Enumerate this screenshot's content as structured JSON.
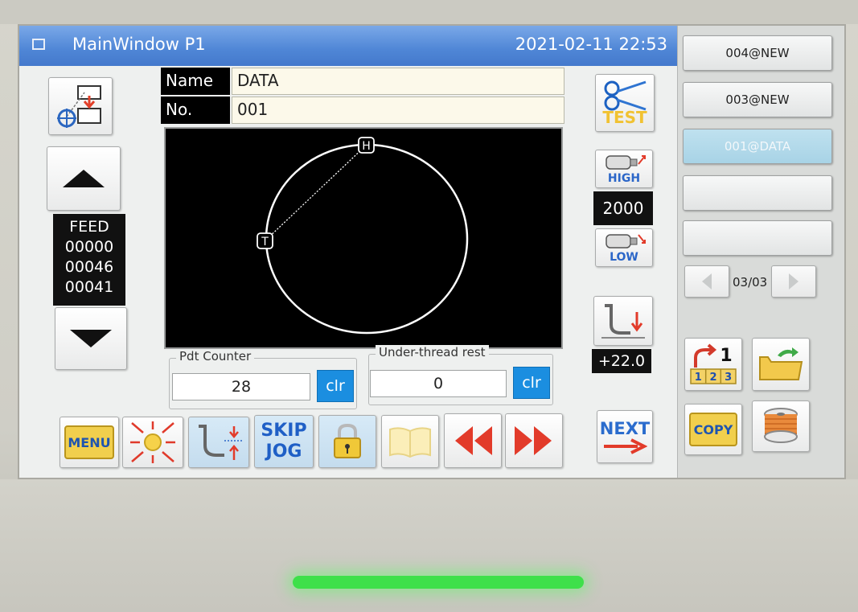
{
  "window": {
    "title": "MainWindow P1",
    "datetime": "2021-02-11 22:53"
  },
  "fields": {
    "name_label": "Name",
    "name_value": "DATA",
    "no_label": "No.",
    "no_value": "001"
  },
  "feed": {
    "label": "FEED",
    "values": [
      "00000",
      "00046",
      "00041"
    ]
  },
  "pattern": {
    "markers": {
      "home": "H",
      "thread": "T"
    }
  },
  "speed": {
    "high_label": "HIGH",
    "value": "2000",
    "low_label": "LOW"
  },
  "presser": {
    "value": "+22.0"
  },
  "counters": {
    "pdt_label": "Pdt Counter",
    "pdt_value": "28",
    "under_label": "Under-thread rest",
    "under_value": "0",
    "clr_label": "clr"
  },
  "toolbar": {
    "menu_label": "MENU",
    "skip_label": "SKIP",
    "jog_label": "JOG",
    "test_label": "TEST",
    "next_label": "NEXT",
    "copy_label": "COPY",
    "number_label": "1",
    "digits": [
      "1",
      "2",
      "3"
    ]
  },
  "programs": [
    {
      "label": "004@NEW",
      "selected": false
    },
    {
      "label": "003@NEW",
      "selected": false
    },
    {
      "label": "001@DATA",
      "selected": true
    },
    {
      "label": "",
      "selected": false
    },
    {
      "label": "",
      "selected": false
    }
  ],
  "pager": {
    "label": "03/03"
  },
  "colors": {
    "title_bar": "#4f86d6",
    "clr_button": "#1b8ee0",
    "selected_item": "#a8d3e6",
    "led": "#3ee04a"
  }
}
